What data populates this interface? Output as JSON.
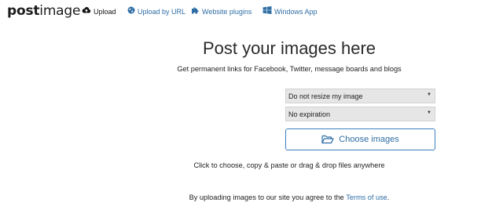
{
  "brand": {
    "name_bold": "post",
    "name_light": "image"
  },
  "nav": {
    "upload": {
      "label": "Upload",
      "icon": "cloud-upload-icon"
    },
    "upload_url": {
      "label": "Upload by URL",
      "icon": "globe-icon"
    },
    "plugins": {
      "label": "Website plugins",
      "icon": "puzzle-icon"
    },
    "windows": {
      "label": "Windows App",
      "icon": "windows-icon"
    }
  },
  "hero": {
    "title": "Post your images here",
    "subtitle": "Get permanent links for Facebook, Twitter, message boards and blogs"
  },
  "form": {
    "resize_selected": "Do not resize my image",
    "expiration_selected": "No expiration",
    "choose_label": "Choose images",
    "choose_icon": "folder-open-icon",
    "hint": "Click to choose, copy & paste or drag & drop files anywhere"
  },
  "footer": {
    "terms_prefix": "By uploading images to our site you agree to the ",
    "terms_link": "Terms of use",
    "terms_suffix": "."
  },
  "colors": {
    "link": "#2f6ea5",
    "button_border": "#3b7fc0",
    "select_bg": "#e6e6e6"
  }
}
